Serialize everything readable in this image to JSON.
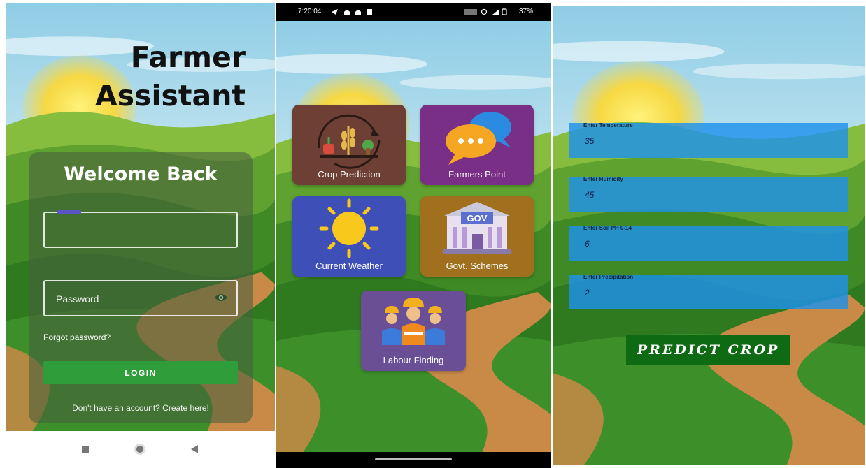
{
  "login": {
    "title_line1": "Farmer",
    "title_line2": "Assistant",
    "heading": "Welcome Back",
    "username_placeholder": "",
    "password_placeholder": "Password",
    "forgot_link": "Forgot password?",
    "login_button": "LOGIN",
    "create_account": "Don't have an account? Create here!",
    "nav_buttons": [
      "recent-apps-icon",
      "home-icon",
      "back-icon"
    ]
  },
  "dashboard": {
    "status_time": "7:20:04",
    "status_right": "37%",
    "tiles": [
      {
        "label": "Crop Prediction",
        "color": "#6e3f34",
        "icon": "crop-cycle-icon"
      },
      {
        "label": "Farmers Point",
        "color": "#7a2f86",
        "icon": "chat-bubbles-icon"
      },
      {
        "label": "Current Weather",
        "color": "#3f4fb8",
        "icon": "sun-icon"
      },
      {
        "label": "Govt. Schemes",
        "color": "#a0701f",
        "icon": "government-building-icon",
        "badge": "GOV"
      },
      {
        "label": "Labour Finding",
        "color": "#6a4f96",
        "icon": "workers-icon"
      }
    ]
  },
  "predict": {
    "fields": [
      {
        "label": "Enter Temperature",
        "value": "35"
      },
      {
        "label": "Enter Humidity",
        "value": "45"
      },
      {
        "label": "Enter Soil PH 0-14",
        "value": "6"
      },
      {
        "label": "Enter Precipitation",
        "value": "2"
      }
    ],
    "button": "PREDICT CROP"
  },
  "colors": {
    "login_button": "#2e9d3a",
    "predict_button": "#0e6b13",
    "input_field": "#1e91eb",
    "sky": "#bfe3f3",
    "sun": "#f6d842"
  }
}
